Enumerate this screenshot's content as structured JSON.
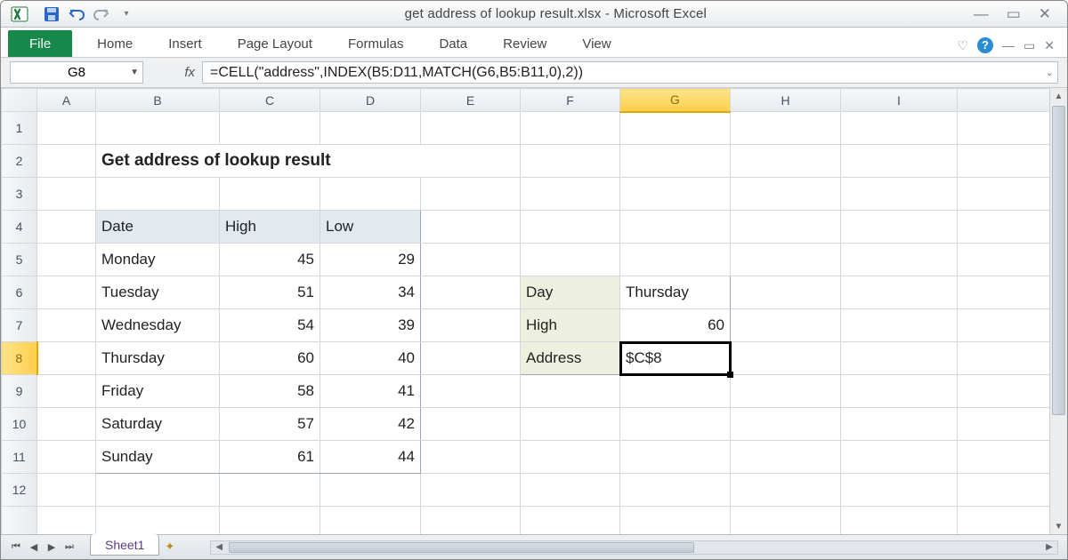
{
  "title": "get address of lookup result.xlsx  -  Microsoft Excel",
  "ribbon": {
    "file": "File",
    "tabs": [
      "Home",
      "Insert",
      "Page Layout",
      "Formulas",
      "Data",
      "Review",
      "View"
    ]
  },
  "namebox": "G8",
  "fx": "fx",
  "formula": "=CELL(\"address\",INDEX(B5:D11,MATCH(G6,B5:B11,0),2))",
  "cols": [
    "A",
    "B",
    "C",
    "D",
    "E",
    "F",
    "G",
    "H",
    "I"
  ],
  "rows": [
    "1",
    "2",
    "3",
    "4",
    "5",
    "6",
    "7",
    "8",
    "9",
    "10",
    "11",
    "12"
  ],
  "sheet": "Sheet1",
  "content": {
    "b2": "Get address of lookup result",
    "hdr": {
      "b4": "Date",
      "c4": "High",
      "d4": "Low"
    },
    "data": [
      {
        "b": "Monday",
        "c": "45",
        "d": "29"
      },
      {
        "b": "Tuesday",
        "c": "51",
        "d": "34"
      },
      {
        "b": "Wednesday",
        "c": "54",
        "d": "39"
      },
      {
        "b": "Thursday",
        "c": "60",
        "d": "40"
      },
      {
        "b": "Friday",
        "c": "58",
        "d": "41"
      },
      {
        "b": "Saturday",
        "c": "57",
        "d": "42"
      },
      {
        "b": "Sunday",
        "c": "61",
        "d": "44"
      }
    ],
    "look": {
      "f6": "Day",
      "g6": "Thursday",
      "f7": "High",
      "g7": "60",
      "f8": "Address",
      "g8": "$C$8"
    }
  },
  "colw": {
    "A": 66,
    "B": 139,
    "C": 113,
    "D": 113,
    "E": 112,
    "F": 112,
    "G": 124,
    "H": 124,
    "I": 131
  }
}
